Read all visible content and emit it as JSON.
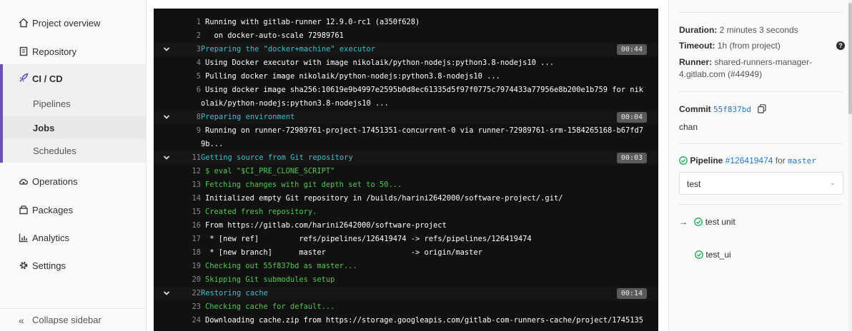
{
  "sidebar": {
    "items": [
      {
        "label": "Project overview",
        "icon": "home-icon"
      },
      {
        "label": "Repository",
        "icon": "doc-icon"
      },
      {
        "label": "CI / CD",
        "icon": "rocket-icon"
      },
      {
        "label": "Operations",
        "icon": "cloud-gear-icon"
      },
      {
        "label": "Packages",
        "icon": "package-icon"
      },
      {
        "label": "Analytics",
        "icon": "chart-icon"
      },
      {
        "label": "Settings",
        "icon": "gear-icon"
      }
    ],
    "cicd_sub": [
      {
        "label": "Pipelines"
      },
      {
        "label": "Jobs",
        "active": true
      },
      {
        "label": "Schedules"
      }
    ],
    "collapse_label": "Collapse sidebar",
    "accent_color": "#6b4fbb"
  },
  "log": {
    "lines": [
      {
        "n": "1",
        "t": "Running with gitlab-runner 12.9.0-rc1 (a350f628)",
        "kind": "plain"
      },
      {
        "n": "2",
        "t": "  on docker-auto-scale 72989761",
        "kind": "plain"
      },
      {
        "n": "3",
        "t": "Preparing the \"docker+machine\" executor",
        "kind": "section",
        "dur": "00:44"
      },
      {
        "n": "4",
        "t": "Using Docker executor with image nikolaik/python-nodejs:python3.8-nodejs10 ...",
        "kind": "plain"
      },
      {
        "n": "5",
        "t": "Pulling docker image nikolaik/python-nodejs:python3.8-nodejs10 ...",
        "kind": "plain"
      },
      {
        "n": "6",
        "t": "Using docker image sha256:10619e9b4997e2595b0d8ec61335d5f97f0775c7974433a77956e8b200e1b759 for nik",
        "kind": "plain"
      },
      {
        "n": "",
        "t": "olaik/python-nodejs:python3.8-nodejs10 ...",
        "kind": "cont"
      },
      {
        "n": "8",
        "t": "Preparing environment",
        "kind": "section",
        "dur": "00:04"
      },
      {
        "n": "9",
        "t": "Running on runner-72989761-project-17451351-concurrent-0 via runner-72989761-srm-1584265168-b67fd7",
        "kind": "plain"
      },
      {
        "n": "",
        "t": "9b...",
        "kind": "cont"
      },
      {
        "n": "11",
        "t": "Getting source from Git repository",
        "kind": "section",
        "dur": "00:03"
      },
      {
        "n": "12",
        "t": "$ eval \"$CI_PRE_CLONE_SCRIPT\"",
        "kind": "green"
      },
      {
        "n": "13",
        "t": "Fetching changes with git depth set to 50...",
        "kind": "green"
      },
      {
        "n": "14",
        "t": "Initialized empty Git repository in /builds/harini2642000/software-project/.git/",
        "kind": "plain"
      },
      {
        "n": "15",
        "t": "Created fresh repository.",
        "kind": "green"
      },
      {
        "n": "16",
        "t": "From https://gitlab.com/harini2642000/software-project",
        "kind": "plain"
      },
      {
        "n": "17",
        "t": " * [new ref]         refs/pipelines/126419474 -> refs/pipelines/126419474",
        "kind": "plain"
      },
      {
        "n": "18",
        "t": " * [new branch]      master                   -> origin/master",
        "kind": "plain"
      },
      {
        "n": "19",
        "t": "Checking out 55f837bd as master...",
        "kind": "green"
      },
      {
        "n": "20",
        "t": "Skipping Git submodules setup",
        "kind": "green"
      },
      {
        "n": "22",
        "t": "Restoring cache",
        "kind": "section",
        "dur": "00:14"
      },
      {
        "n": "23",
        "t": "Checking cache for default...",
        "kind": "green"
      },
      {
        "n": "24",
        "t": "Downloading cache.zip from https://storage.googleapis.com/gitlab-com-runners-cache/project/1745135",
        "kind": "plain"
      }
    ]
  },
  "details": {
    "duration_label": "Duration:",
    "duration_value": " 2 minutes 3 seconds",
    "timeout_label": "Timeout:",
    "timeout_value": " 1h (from project)",
    "runner_label": "Runner:",
    "runner_value": " shared-runners-manager-4.gitlab.com (#44949)",
    "commit_label": "Commit",
    "commit_sha": "55f837bd",
    "commit_title": "chan",
    "pipeline_label": "Pipeline",
    "pipeline_id": "#126419474",
    "pipeline_for": "for",
    "pipeline_ref": "master",
    "stage_select": "test",
    "jobs": [
      {
        "label": "test unit",
        "current": true
      },
      {
        "label": "test_ui",
        "current": false
      }
    ],
    "success_color": "#1aaa55"
  }
}
